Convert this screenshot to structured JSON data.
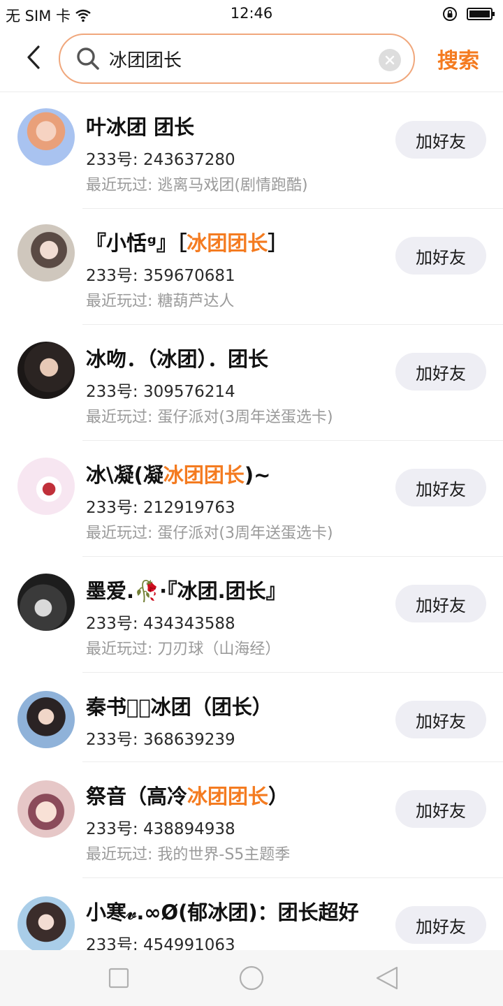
{
  "status_bar": {
    "carrier": "无 SIM 卡",
    "time": "12:46"
  },
  "header": {
    "search_value": "冰团团长",
    "search_button": "搜索"
  },
  "results": [
    {
      "name_parts": [
        "叶冰团 团长",
        "",
        ""
      ],
      "uid": "233号: 243637280",
      "recent": "最近玩过: 逃离马戏团(剧情跑酷)",
      "add_label": "加好友"
    },
    {
      "name_parts": [
        "『小恬ᵍ』［",
        "冰团团长",
        "］"
      ],
      "uid": "233号: 359670681",
      "recent": "最近玩过: 糖葫芦达人",
      "add_label": "加好友"
    },
    {
      "name_parts": [
        "冰吻．（冰团）．团长",
        "",
        ""
      ],
      "uid": "233号: 309576214",
      "recent": "最近玩过: 蛋仔派对(3周年送蛋选卡)",
      "add_label": "加好友"
    },
    {
      "name_parts": [
        "冰\\凝(凝",
        "冰团团长",
        ")~"
      ],
      "uid": "233号: 212919763",
      "recent": "最近玩过: 蛋仔派对(3周年送蛋选卡)",
      "add_label": "加好友"
    },
    {
      "name_parts": [
        "墨爱.🥀·『冰团.团长』",
        "",
        ""
      ],
      "uid": "233号: 434343588",
      "recent": "最近玩过: 刀刃球（山海经）",
      "add_label": "加好友"
    },
    {
      "name_parts": [
        "秦书忆⃟冰团（团长）",
        "",
        ""
      ],
      "uid": "233号: 368639239",
      "recent": "",
      "add_label": "加好友"
    },
    {
      "name_parts": [
        "祭音（高冷",
        "冰团团长",
        "）"
      ],
      "uid": "233号: 438894938",
      "recent": "最近玩过: 我的世界-S5主题季",
      "add_label": "加好友"
    },
    {
      "name_parts": [
        "小寒𝓋.∞Ø(郁冰团)：团长超好",
        "",
        ""
      ],
      "uid": "233号: 454991063",
      "recent": "",
      "add_label": "加好友"
    }
  ],
  "colors": {
    "accent": "#f47b20",
    "search_border": "#f0a77c",
    "button_bg": "#eeeef4"
  },
  "icons": {
    "back": "chevron-left-icon",
    "search": "search-icon",
    "clear": "close-icon",
    "nav_recent": "square-icon",
    "nav_home": "circle-icon",
    "nav_back": "triangle-back-icon"
  }
}
